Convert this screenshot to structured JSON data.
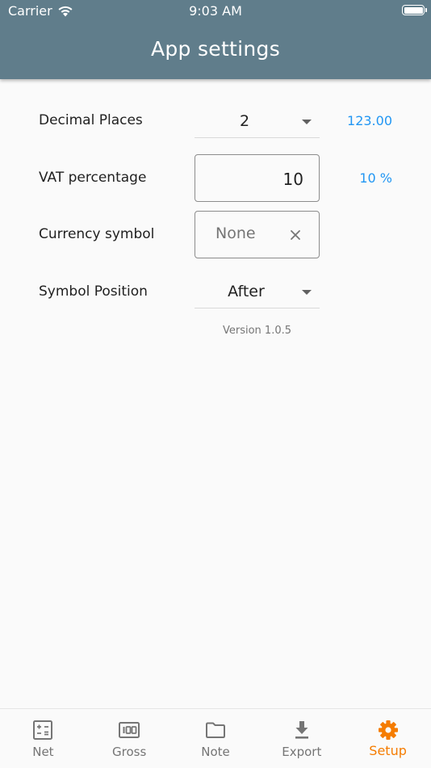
{
  "status_bar": {
    "carrier": "Carrier",
    "time": "9:03 AM"
  },
  "header": {
    "title": "App settings"
  },
  "settings": {
    "decimal_places": {
      "label": "Decimal Places",
      "value": "2",
      "preview": "123.00"
    },
    "vat_percentage": {
      "label": "VAT percentage",
      "value": "10",
      "preview": "10 %"
    },
    "currency_symbol": {
      "label": "Currency symbol",
      "placeholder": "None"
    },
    "symbol_position": {
      "label": "Symbol Position",
      "value": "After"
    },
    "version": "Version 1.0.5"
  },
  "bottom_nav": {
    "items": [
      {
        "label": "Net",
        "icon": "calculator-icon"
      },
      {
        "label": "Gross",
        "icon": "counter-100-icon"
      },
      {
        "label": "Note",
        "icon": "folder-icon"
      },
      {
        "label": "Export",
        "icon": "download-icon"
      },
      {
        "label": "Setup",
        "icon": "gear-icon",
        "active": true
      }
    ],
    "active_color": "#f57c00",
    "inactive_color": "#757575"
  },
  "colors": {
    "header": "#607d8b",
    "accent_blue": "#2196f3",
    "background": "#fafafa"
  }
}
